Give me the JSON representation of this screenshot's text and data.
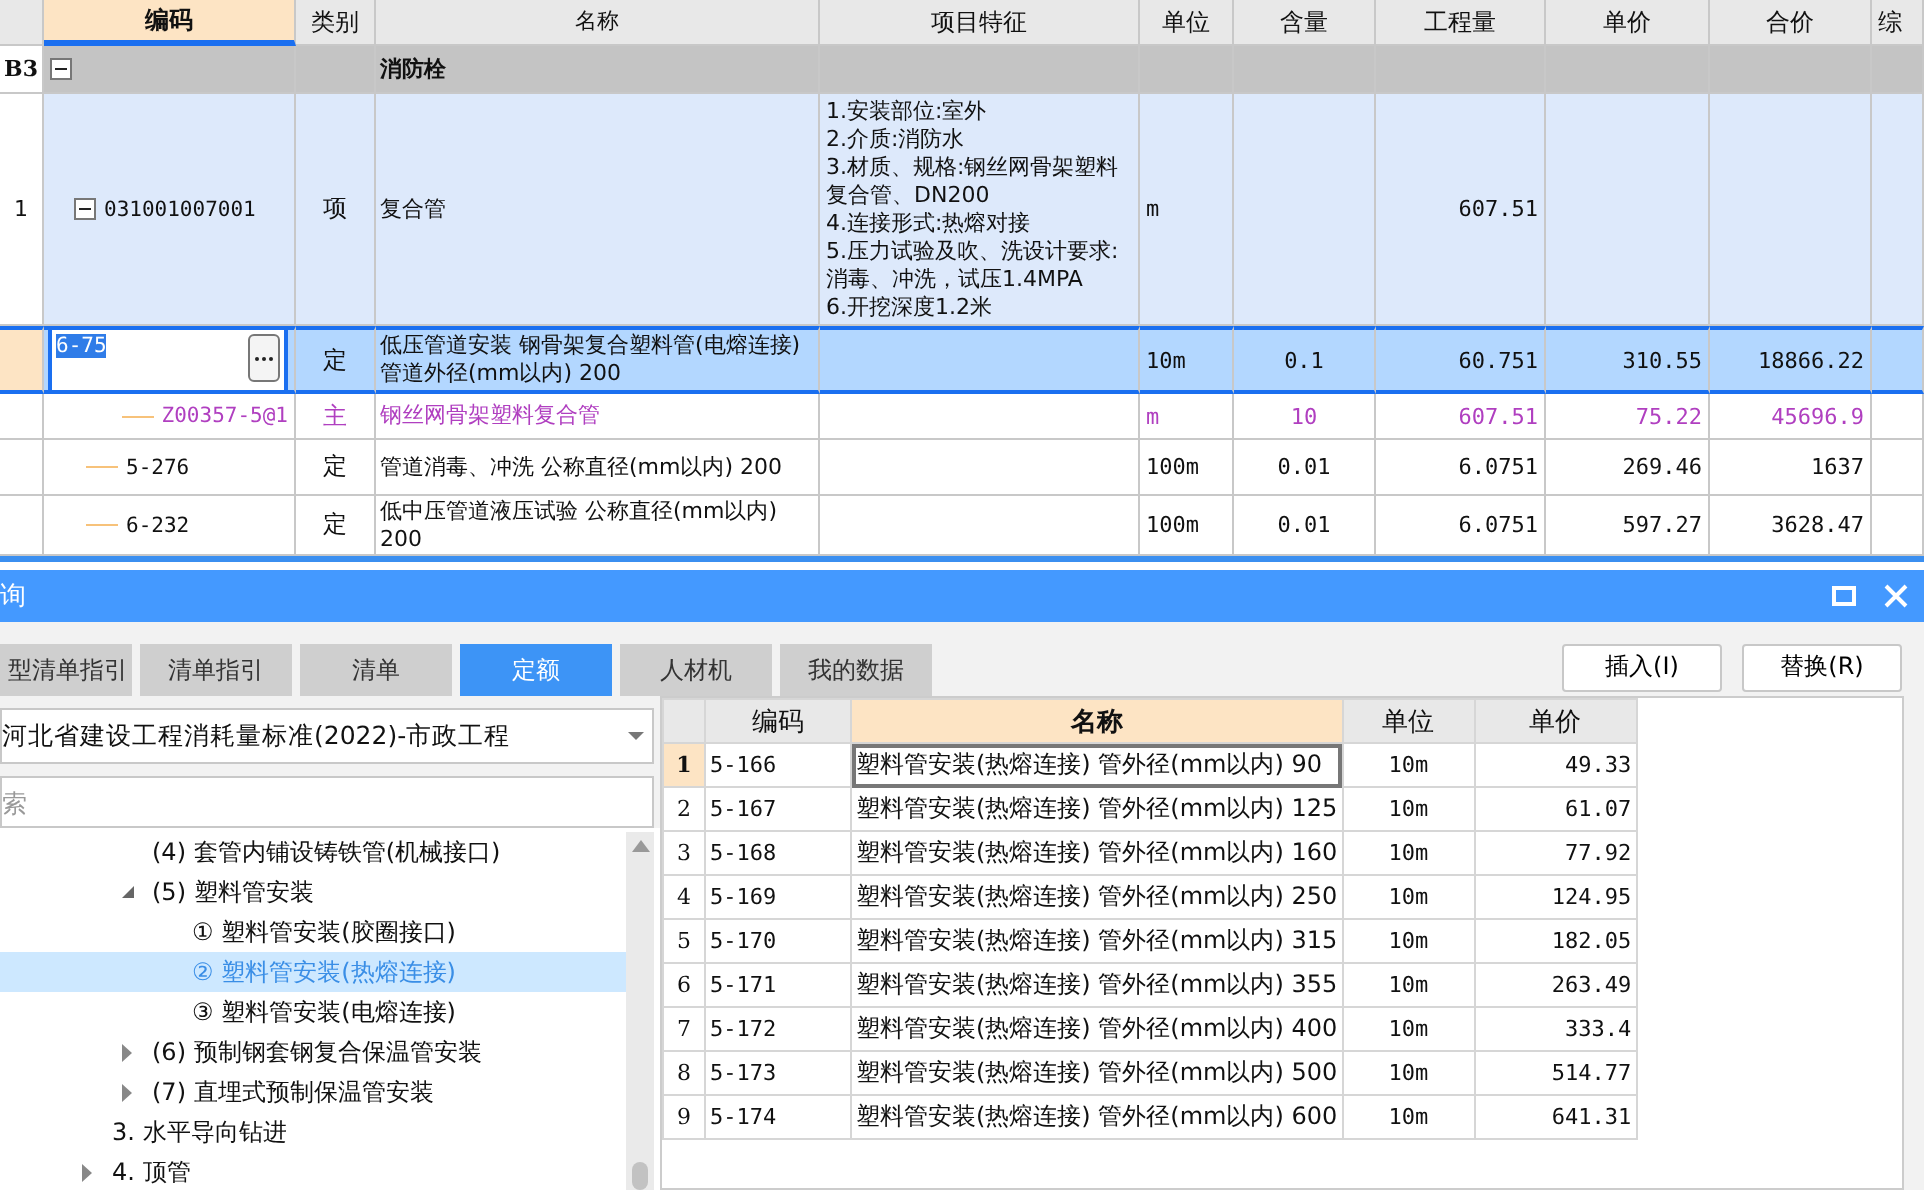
{
  "grid": {
    "columns": [
      {
        "label": "编码",
        "selected": true
      },
      {
        "label": "类别",
        "selected": false
      },
      {
        "label": "名称",
        "selected": false
      },
      {
        "label": "项目特征",
        "selected": false
      },
      {
        "label": "单位",
        "selected": false
      },
      {
        "label": "含量",
        "selected": false
      },
      {
        "label": "工程量",
        "selected": false
      },
      {
        "label": "单价",
        "selected": false
      },
      {
        "label": "合价",
        "selected": false
      },
      {
        "label": "综",
        "selected": false
      }
    ],
    "rows": [
      {
        "kind": "section",
        "row_no": "B3",
        "expanded": true,
        "selected": false,
        "name": "消防栓",
        "children": [
          {
            "kind": "item",
            "row_no": "1",
            "expanded": true,
            "selected": false,
            "code": "031001007001",
            "type": "项",
            "name": "复合管",
            "feature": "1.安装部位:室外\n2.介质:消防水\n3.材质、规格:钢丝网骨架塑料复合管、DN200\n4.连接形式:热熔对接\n5.压力试验及吹、洗设计要求:消毒、冲洗，试压1.4MPA\n6.开挖深度1.2米",
            "unit": "m",
            "qty": "607.51",
            "children": [
              {
                "kind": "quota",
                "selected": true,
                "code": "6-75",
                "type": "定",
                "name": "低压管道安装 钢骨架复合塑料管(电熔连接) 管道外径(mm以内) 200",
                "unit": "10m",
                "content": "0.1",
                "qty": "60.751",
                "price": "310.55",
                "total": "18866.22",
                "children": [
                  {
                    "kind": "material",
                    "selected": false,
                    "code": "Z00357-5@1",
                    "type": "主",
                    "name": "钢丝网骨架塑料复合管",
                    "unit": "m",
                    "content": "10",
                    "qty": "607.51",
                    "price": "75.22",
                    "total": "45696.9"
                  }
                ]
              },
              {
                "kind": "quota",
                "selected": false,
                "code": "5-276",
                "type": "定",
                "name": "管道消毒、冲洗 公称直径(mm以内) 200",
                "unit": "100m",
                "content": "0.01",
                "qty": "6.0751",
                "price": "269.46",
                "total": "1637"
              },
              {
                "kind": "quota",
                "selected": false,
                "code": "6-232",
                "type": "定",
                "name": "低中压管道液压试验 公称直径(mm以内) 200",
                "unit": "100m",
                "content": "0.01",
                "qty": "6.0751",
                "price": "597.27",
                "total": "3628.47"
              }
            ]
          }
        ]
      }
    ]
  },
  "dialog": {
    "title": "询",
    "tabs": [
      {
        "label": "型清单指引",
        "selected": false
      },
      {
        "label": "清单指引",
        "selected": false
      },
      {
        "label": "清单",
        "selected": false
      },
      {
        "label": "定额",
        "selected": true
      },
      {
        "label": "人材机",
        "selected": false
      },
      {
        "label": "我的数据",
        "selected": false
      }
    ],
    "buttons": [
      "插入(I)",
      "替换(R)"
    ],
    "library": "河北省建设工程消耗量标准(2022)-市政工程",
    "search": {
      "placeholder": "索"
    },
    "tree": {
      "continued_children": [
        {
          "label": "(4) 套管内铺设铸铁管(机械接口)",
          "selected": false
        },
        {
          "label": "(5) 塑料管安装",
          "selected": false,
          "expanded": true,
          "children": [
            {
              "label": "① 塑料管安装(胶圈接口)",
              "selected": false
            },
            {
              "label": "② 塑料管安装(热熔连接)",
              "selected": true
            },
            {
              "label": "③ 塑料管安装(电熔连接)",
              "selected": false
            }
          ]
        },
        {
          "label": "(6) 预制钢套钢复合保温管安装",
          "selected": false,
          "expanded": false
        },
        {
          "label": "(7) 直埋式预制保温管安装",
          "selected": false,
          "expanded": false
        }
      ],
      "items": [
        {
          "label": "3. 水平导向钻进",
          "selected": false
        },
        {
          "label": "4. 顶管",
          "selected": false,
          "expanded": false
        }
      ]
    },
    "table": {
      "columns": [
        {
          "label": "编码",
          "selected": false
        },
        {
          "label": "名称",
          "selected": true
        },
        {
          "label": "单位",
          "selected": false
        },
        {
          "label": "单价",
          "selected": false
        }
      ],
      "rows": [
        {
          "no": "1",
          "code": "5-166",
          "name": "塑料管安装(热熔连接) 管外径(mm以内) 90",
          "unit": "10m",
          "price": "49.33",
          "selected": true
        },
        {
          "no": "2",
          "code": "5-167",
          "name": "塑料管安装(热熔连接) 管外径(mm以内) 125",
          "unit": "10m",
          "price": "61.07",
          "selected": false
        },
        {
          "no": "3",
          "code": "5-168",
          "name": "塑料管安装(热熔连接) 管外径(mm以内) 160",
          "unit": "10m",
          "price": "77.92",
          "selected": false
        },
        {
          "no": "4",
          "code": "5-169",
          "name": "塑料管安装(热熔连接) 管外径(mm以内) 250",
          "unit": "10m",
          "price": "124.95",
          "selected": false
        },
        {
          "no": "5",
          "code": "5-170",
          "name": "塑料管安装(热熔连接) 管外径(mm以内) 315",
          "unit": "10m",
          "price": "182.05",
          "selected": false
        },
        {
          "no": "6",
          "code": "5-171",
          "name": "塑料管安装(热熔连接) 管外径(mm以内) 355",
          "unit": "10m",
          "price": "263.49",
          "selected": false
        },
        {
          "no": "7",
          "code": "5-172",
          "name": "塑料管安装(热熔连接) 管外径(mm以内) 400",
          "unit": "10m",
          "price": "333.4",
          "selected": false
        },
        {
          "no": "8",
          "code": "5-173",
          "name": "塑料管安装(热熔连接) 管外径(mm以内) 500",
          "unit": "10m",
          "price": "514.77",
          "selected": false
        },
        {
          "no": "9",
          "code": "5-174",
          "name": "塑料管安装(热熔连接) 管外径(mm以内) 600",
          "unit": "10m",
          "price": "641.31",
          "selected": false
        }
      ]
    }
  }
}
